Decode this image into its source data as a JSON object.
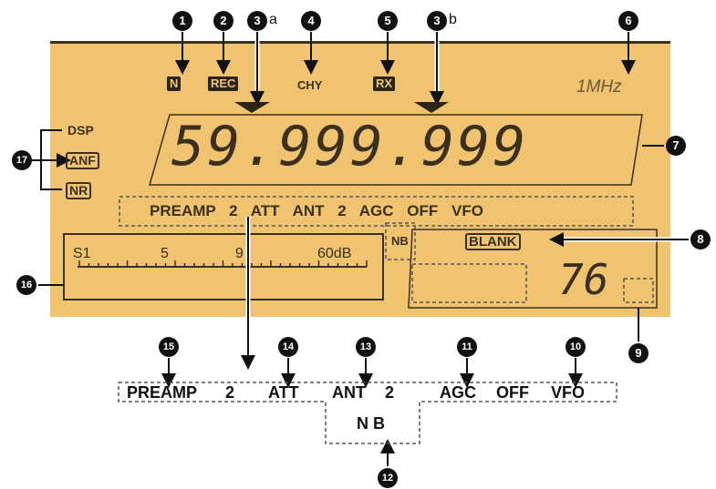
{
  "display": {
    "n_icon": "N",
    "rec_icon": "REC",
    "chy_text": "CHY",
    "rx_icon": "RX",
    "mhz_text": "1MHz",
    "dsp_label": "DSP",
    "anf_label": "ANF",
    "nr_label": "NR",
    "frequency": "59.999.999",
    "status_row": "PREAMP 2 ATT ANT 2 AGC OFF VFO",
    "nb_label": "NB",
    "blank_label": "BLANK",
    "channel_number": "76",
    "meter_scale": [
      "S1",
      "5",
      "9",
      "60dB"
    ]
  },
  "callouts": {
    "c1": "1",
    "c2": "2",
    "c3": "3",
    "c3a_suffix": "a",
    "c3b": "3",
    "c3b_suffix": "b",
    "c4": "4",
    "c5": "5",
    "c6": "6",
    "c7": "7",
    "c8": "8",
    "c9": "9",
    "c10": "10",
    "c11": "11",
    "c12": "12",
    "c13": "13",
    "c14": "14",
    "c15": "15",
    "c16": "16",
    "c17": "17"
  },
  "bottom_labels": {
    "preamp": "PREAMP",
    "preamp_num": "2",
    "att": "ATT",
    "ant": "ANT",
    "ant_num": "2",
    "agc": "AGC",
    "off": "OFF",
    "vfo": "VFO",
    "nb": "N B"
  },
  "colors": {
    "lcd_bg": "#efc36f",
    "lcd_text": "#3b2f1f",
    "callout": "#111111"
  }
}
